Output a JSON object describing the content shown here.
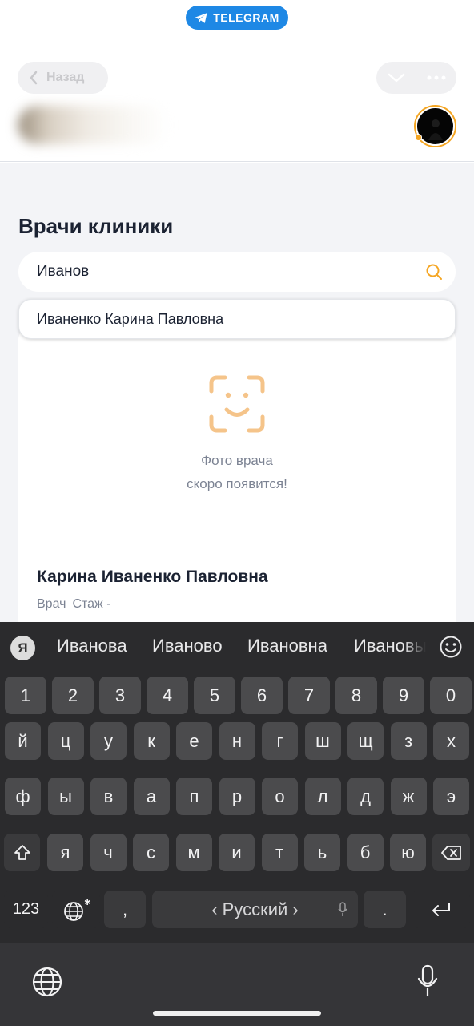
{
  "header": {
    "badge_label": "TELEGRAM",
    "back_label": "Назад"
  },
  "page": {
    "title": "Врачи клиники",
    "search_value": "Иванов",
    "suggestion": "Иваненко Карина Павловна",
    "photo_placeholder_line1": "Фото врача",
    "photo_placeholder_line2": "скоро появится!",
    "doctor_name": "Карина Иваненко Павловна",
    "doctor_role": "Врач",
    "doctor_experience": "Стаж -"
  },
  "keyboard": {
    "logo": "Я",
    "suggestions": [
      "Иванова",
      "Иваново",
      "Ивановна",
      "Ивановы"
    ],
    "digits": [
      "1",
      "2",
      "3",
      "4",
      "5",
      "6",
      "7",
      "8",
      "9",
      "0"
    ],
    "row1": [
      "й",
      "ц",
      "у",
      "к",
      "е",
      "н",
      "г",
      "ш",
      "щ",
      "з",
      "х"
    ],
    "row2": [
      "ф",
      "ы",
      "в",
      "а",
      "п",
      "р",
      "о",
      "л",
      "д",
      "ж",
      "э"
    ],
    "row3": [
      "я",
      "ч",
      "с",
      "м",
      "и",
      "т",
      "ь",
      "б",
      "ю"
    ],
    "numbers_key": "123",
    "comma_key": ",",
    "space_label": "‹ Русский ›",
    "period_key": "."
  },
  "colors": {
    "accent_orange": "#f5a623",
    "telegram_blue": "#1e88e5",
    "keyboard_bg": "#2b2b2d",
    "key_bg": "#4b4b4d"
  },
  "icons": [
    "telegram-plane-icon",
    "chevron-left-icon",
    "chevron-down-icon",
    "more-dots-icon",
    "search-icon",
    "face-scan-icon",
    "emoji-icon",
    "shift-icon",
    "backspace-icon",
    "globe-icon",
    "mic-icon",
    "return-icon"
  ]
}
